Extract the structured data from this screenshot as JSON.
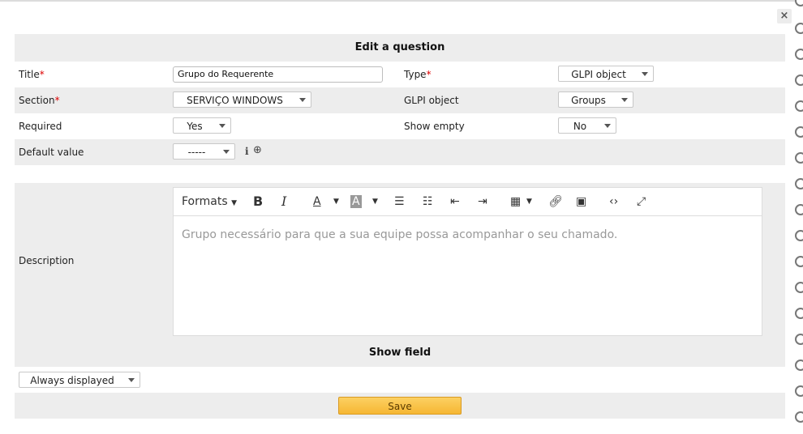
{
  "dialog": {
    "close_label": "×",
    "header": "Edit a question"
  },
  "fields": {
    "title_label": "Title",
    "required_marker": "*",
    "title_value": "Grupo do Requerente",
    "type_label": "Type",
    "type_value": "GLPI object",
    "section_label": "Section",
    "section_value": "SERVIÇO WINDOWS",
    "glpi_object_label": "GLPI object",
    "glpi_object_value": "Groups",
    "required_label": "Required",
    "required_value": "Yes",
    "show_empty_label": "Show empty",
    "show_empty_value": "No",
    "default_value_label": "Default value",
    "default_value_value": "-----",
    "info_icon": "i",
    "add_icon": "⊕"
  },
  "description": {
    "label": "Description",
    "toolbar": {
      "formats": "Formats",
      "bold": "B",
      "italic": "I",
      "text_color": "A",
      "bg_color": "A"
    },
    "content": "Grupo necessário para que a sua equipe possa acompanhar o seu chamado."
  },
  "show_field": {
    "header": "Show field",
    "value": "Always displayed"
  },
  "save_label": "Save"
}
